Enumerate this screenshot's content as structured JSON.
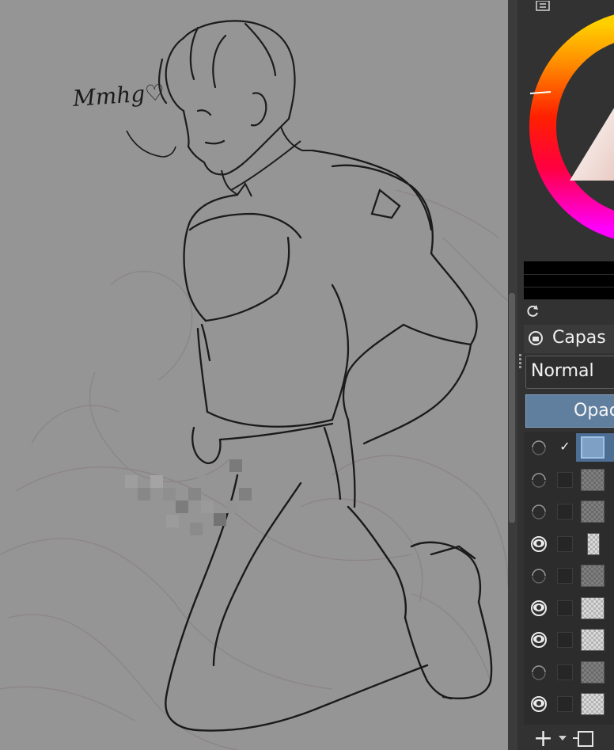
{
  "canvas": {
    "handwritten_note": "Mmhg♡"
  },
  "color_panel": {
    "docker_icon": "list-icon",
    "refresh_icon": "refresh-icon"
  },
  "layers": {
    "title": "Capas",
    "blend_mode": "Normal",
    "opacity_label": "Opac",
    "rows": [
      {
        "visible": false,
        "checked": true,
        "thumb": "blue",
        "selected": true
      },
      {
        "visible": false,
        "checked": false,
        "thumb": "dark",
        "selected": false
      },
      {
        "visible": false,
        "checked": false,
        "thumb": "dark",
        "selected": false
      },
      {
        "visible": true,
        "checked": false,
        "thumb": "narrow",
        "selected": false
      },
      {
        "visible": false,
        "checked": false,
        "thumb": "dark",
        "selected": false
      },
      {
        "visible": true,
        "checked": false,
        "thumb": "checker",
        "selected": false
      },
      {
        "visible": true,
        "checked": false,
        "thumb": "checker",
        "selected": false
      },
      {
        "visible": false,
        "checked": false,
        "thumb": "dark",
        "selected": false
      },
      {
        "visible": true,
        "checked": false,
        "thumb": "checker",
        "selected": false
      }
    ],
    "check_mark": "✓",
    "add_label": "+"
  },
  "colors": {
    "canvas_bg": "#959595",
    "panel_bg": "#323232",
    "accent": "#607f9f"
  }
}
